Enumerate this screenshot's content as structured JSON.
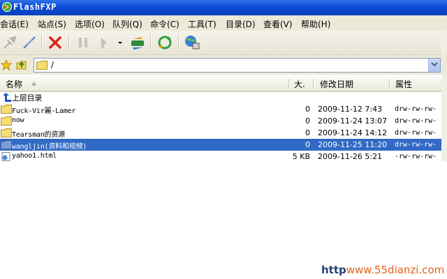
{
  "window": {
    "title": "FlashFXP"
  },
  "menu": [
    {
      "label": "会话(E)"
    },
    {
      "label": "站点(S)"
    },
    {
      "label": "选项(O)"
    },
    {
      "label": "队列(Q)"
    },
    {
      "label": "命令(C)"
    },
    {
      "label": "工具(T)"
    },
    {
      "label": "目录(D)"
    },
    {
      "label": "查看(V)"
    },
    {
      "label": "帮助(H)"
    }
  ],
  "toolbar": {
    "icons": [
      "connect-icon",
      "disconnect-icon",
      "abort-icon",
      "pause-icon",
      "transfer-icon",
      "dropdown-arrow-icon",
      "refresh-transfer-icon",
      "refresh-icon",
      "site-manager-icon"
    ]
  },
  "pathbar": {
    "path": "/"
  },
  "list": {
    "columns": {
      "name": "名称",
      "size": "大.",
      "date": "修改日期",
      "attr": "属性"
    },
    "parent_label": "上层目录",
    "rows": [
      {
        "name": "Fuck-Vir麗-Lamer",
        "size": "0",
        "date": "2009-11-12 7:43",
        "attr": "drw-rw-rw-"
      },
      {
        "name": "now",
        "size": "0",
        "date": "2009-11-24 13:07",
        "attr": "drw-rw-rw-"
      },
      {
        "name": "Tearsman的资源",
        "size": "0",
        "date": "2009-11-24 14:12",
        "attr": "drw-rw-rw-"
      },
      {
        "name": "wangljin(资料和视频)",
        "size": "0",
        "date": "2009-11-25 11:20",
        "attr": "drw-rw-rw-"
      },
      {
        "name": "yahoo1.html",
        "size": "5 KB",
        "date": "2009-11-26 5:21",
        "attr": "-rw-rw-rw-"
      }
    ],
    "selected_index": 3
  },
  "watermark": {
    "prefix": "http",
    "site": "www.55dianzi.com"
  },
  "colors": {
    "titlebar": "#0c4ad4",
    "selection": "#316ac5",
    "chrome": "#ece9d8"
  }
}
